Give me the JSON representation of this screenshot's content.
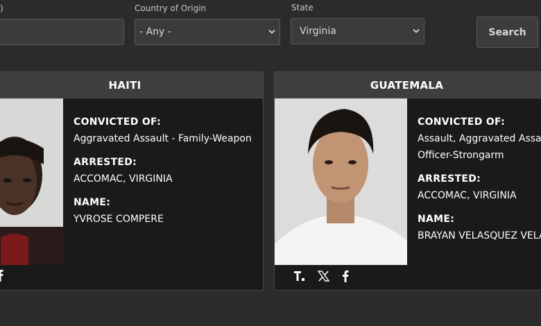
{
  "filters": {
    "field1_label_fragment": ")",
    "country_label": "Country of Origin",
    "country_value": "- Any -",
    "state_label": "State",
    "state_value": "Virginia",
    "search_label": "Search"
  },
  "cards": [
    {
      "country": "HAITI",
      "convicted_label": "CONVICTED OF:",
      "convicted_value": "Aggravated Assault - Family-Weapon",
      "arrested_label": "ARRESTED:",
      "arrested_value": "ACCOMAC, VIRGINIA",
      "name_label": "NAME:",
      "name_value": "YVROSE COMPERE",
      "social": [
        "facebook-icon"
      ]
    },
    {
      "country": "GUATEMALA",
      "convicted_label": "CONVICTED OF:",
      "convicted_value_line1": "Assault, Aggravated Assaul",
      "convicted_value_line2": "Officer-Strongarm",
      "arrested_label": "ARRESTED:",
      "arrested_value": "ACCOMAC, VIRGINIA",
      "name_label": "NAME:",
      "name_value": "BRAYAN VELASQUEZ VELAS",
      "social": [
        "truth-social-icon",
        "x-icon",
        "facebook-icon"
      ]
    }
  ]
}
